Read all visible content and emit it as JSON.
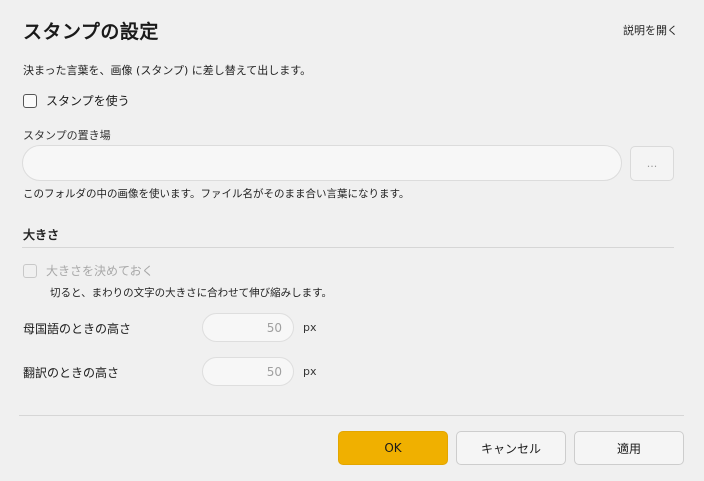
{
  "dialog": {
    "title": "スタンプの設定",
    "help_link": "説明を開く",
    "description": "決まった言葉を、画像 (スタンプ) に差し替えて出します。"
  },
  "use_stamps": {
    "label": "スタンプを使う",
    "checked": false
  },
  "folder": {
    "label": "スタンプの置き場",
    "value": "",
    "browse_label": "...",
    "note": "このフォルダの中の画像を使います。ファイル名がそのまま合い言葉になります。"
  },
  "size_section": {
    "title": "大きさ",
    "fix_size": {
      "label": "大きさを決めておく",
      "checked": false,
      "enabled": false
    },
    "fix_note": "切ると、まわりの文字の大きさに合わせて伸び縮みします。",
    "native_height": {
      "label": "母国語のときの高さ",
      "value": "50",
      "unit": "px"
    },
    "translation_height": {
      "label": "翻訳のときの高さ",
      "value": "50",
      "unit": "px"
    }
  },
  "buttons": {
    "ok": "OK",
    "cancel": "キャンセル",
    "apply": "適用"
  },
  "colors": {
    "primary": "#f0b000",
    "background": "#f0f0f0"
  }
}
